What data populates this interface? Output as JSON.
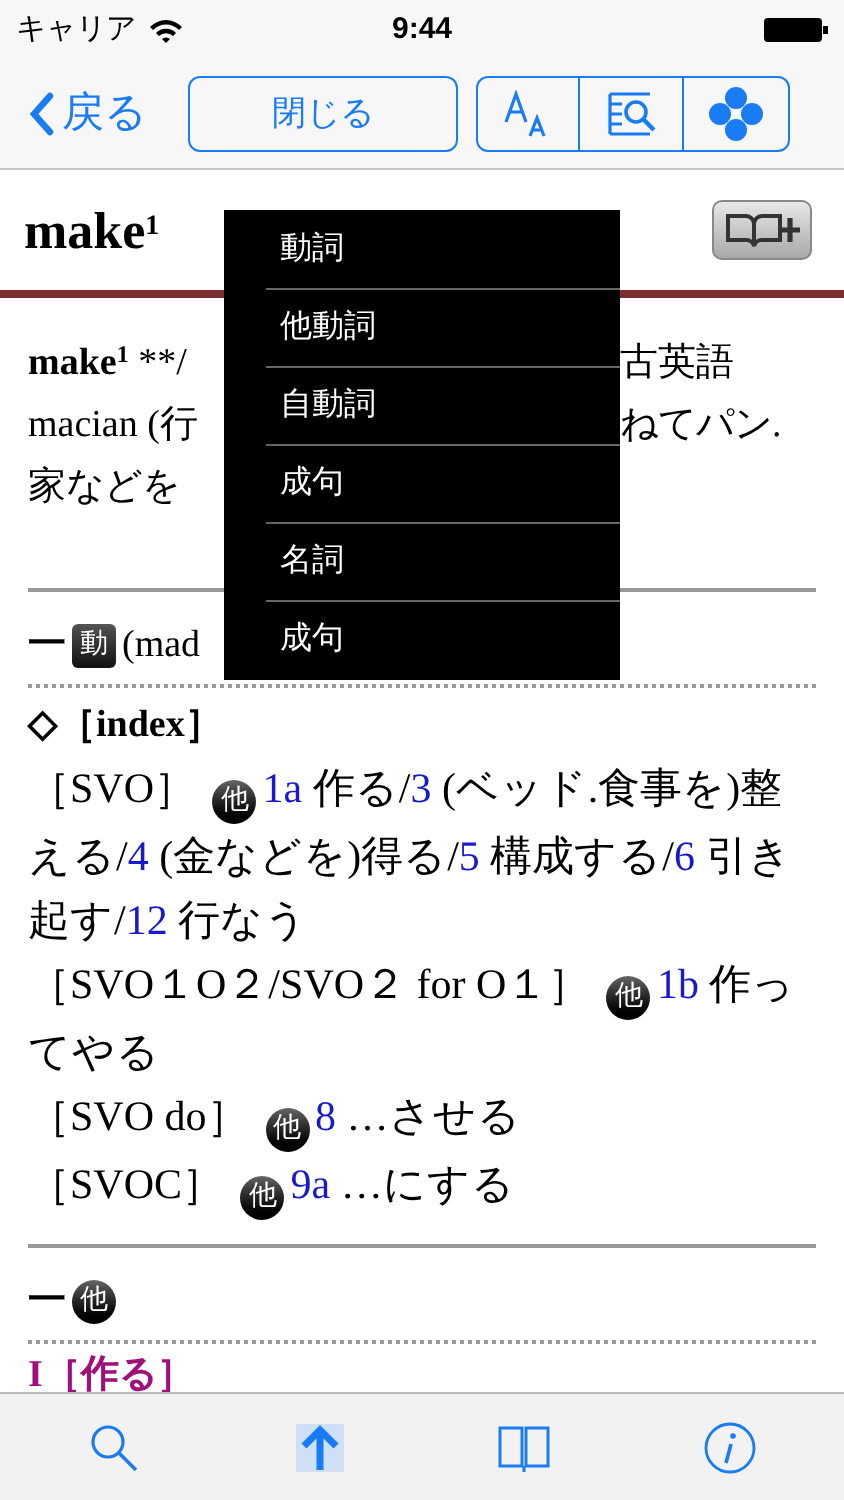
{
  "status_bar": {
    "carrier": "キャリア",
    "time": "9:44"
  },
  "nav": {
    "back": "戻る",
    "close": "閉じる"
  },
  "headword": {
    "word": "make",
    "sup": "1"
  },
  "etymology": [
    {
      "left": [
        {
          "kind": "bold",
          "text": "make"
        },
        {
          "kind": "boldsup",
          "text": "1"
        },
        {
          "kind": "plain",
          "text": " **/"
        }
      ],
      "right": "古英語"
    },
    {
      "left": [
        {
          "kind": "plain",
          "text": "macian (行"
        }
      ],
      "right": "ねてパン."
    },
    {
      "left": [
        {
          "kind": "plain",
          "text": "家などを"
        }
      ]
    }
  ],
  "blocks": [
    {
      "kind": "rule"
    },
    {
      "kind": "pos",
      "dash": "一",
      "badge": {
        "kind": "square",
        "text": "動"
      },
      "text": "(mad"
    },
    {
      "kind": "dotted"
    },
    {
      "kind": "heading",
      "text": "◇［index］"
    },
    {
      "kind": "entry",
      "segments": [
        {
          "kind": "plain",
          "text": "［SVO］ "
        },
        {
          "kind": "badge",
          "text": "他"
        },
        {
          "kind": "link",
          "text": "1a"
        },
        {
          "kind": "plain",
          "text": " 作る/"
        },
        {
          "kind": "link",
          "text": "3"
        },
        {
          "kind": "plain",
          "text": " (ベッド.食事を)整える/"
        },
        {
          "kind": "link",
          "text": "4"
        },
        {
          "kind": "plain",
          "text": " (金などを)得る/"
        },
        {
          "kind": "link",
          "text": "5"
        },
        {
          "kind": "plain",
          "text": " 構成する/"
        },
        {
          "kind": "link",
          "text": "6"
        },
        {
          "kind": "plain",
          "text": " 引き起す/"
        },
        {
          "kind": "link",
          "text": "12"
        },
        {
          "kind": "plain",
          "text": " 行なう"
        }
      ]
    },
    {
      "kind": "entry",
      "segments": [
        {
          "kind": "plain",
          "text": "［SVO１O２/SVO２ for O１］ "
        },
        {
          "kind": "badge",
          "text": "他"
        },
        {
          "kind": "link",
          "text": "1b"
        },
        {
          "kind": "plain",
          "text": " 作ってやる"
        }
      ]
    },
    {
      "kind": "entry",
      "segments": [
        {
          "kind": "plain",
          "text": "［SVO do］ "
        },
        {
          "kind": "badge",
          "text": "他"
        },
        {
          "kind": "link",
          "text": "8"
        },
        {
          "kind": "plain",
          "text": " …させる"
        }
      ]
    },
    {
      "kind": "entry",
      "segments": [
        {
          "kind": "plain",
          "text": "［SVOC］ "
        },
        {
          "kind": "badge",
          "text": "他"
        },
        {
          "kind": "link",
          "text": "9a"
        },
        {
          "kind": "plain",
          "text": " …にする"
        }
      ]
    },
    {
      "kind": "rule"
    },
    {
      "kind": "pos",
      "dash": "一",
      "badge": {
        "kind": "circle",
        "text": "他"
      }
    },
    {
      "kind": "dotted"
    },
    {
      "kind": "sense",
      "text": "I［作る］"
    }
  ],
  "menu": {
    "items": [
      {
        "label": "動詞"
      },
      {
        "label": "他動詞"
      },
      {
        "label": "自動詞"
      },
      {
        "label": "成句"
      },
      {
        "label": "名詞"
      },
      {
        "label": "成句"
      }
    ]
  }
}
